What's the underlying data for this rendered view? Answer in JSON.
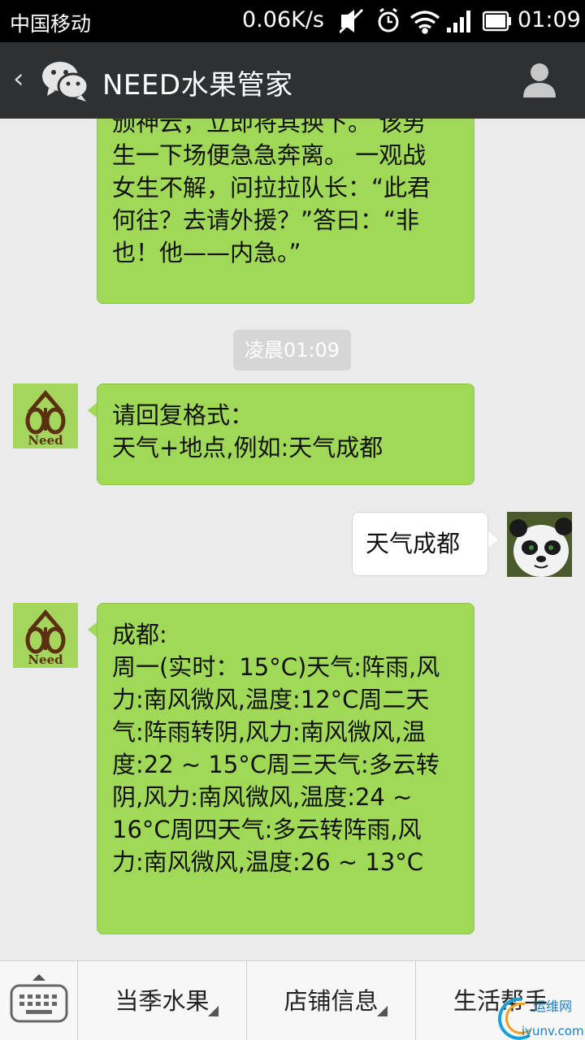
{
  "status_bar": {
    "carrier": "中国移动",
    "net_speed": "0.06K/s",
    "time": "01:09"
  },
  "header": {
    "title": "NEED水果管家"
  },
  "messages": {
    "m1": {
      "sender": "Need",
      "text": "颁神云，立即将其换下。 该男\n生一下场便急急奔离。 一观战\n女生不解，问拉拉队长：“此君\n何往？去请外援？”答曰：“非\n也！他——内急。”"
    },
    "timestamp": "凌晨01:09",
    "m2": {
      "sender": "Need",
      "text": "请回复格式：\n天气+地点,例如:天气成都"
    },
    "m3": {
      "sender": "user",
      "text": "天气成都"
    },
    "m4": {
      "sender": "Need",
      "text": "成都:\n周一(实时：15°C)天气:阵雨,风\n力:南风微风,温度:12°C周二天\n气:阵雨转阴,风力:南风微风,温\n度:22 ~ 15°C周三天气:多云转\n阴,风力:南风微风,温度:24 ~\n16°C周四天气:多云转阵雨,风\n力:南风微风,温度:26 ~ 13°C"
    }
  },
  "avatar_need_label": "Need",
  "bottom_menu": {
    "items": [
      "当季水果",
      "店铺信息",
      "生活帮手"
    ]
  },
  "watermark": {
    "line1": "运维网",
    "line2": "iyunv.com"
  },
  "colors": {
    "header_bg": "#2e3134",
    "bubble_green": "#a0d957",
    "chat_bg": "#ebebeb"
  }
}
